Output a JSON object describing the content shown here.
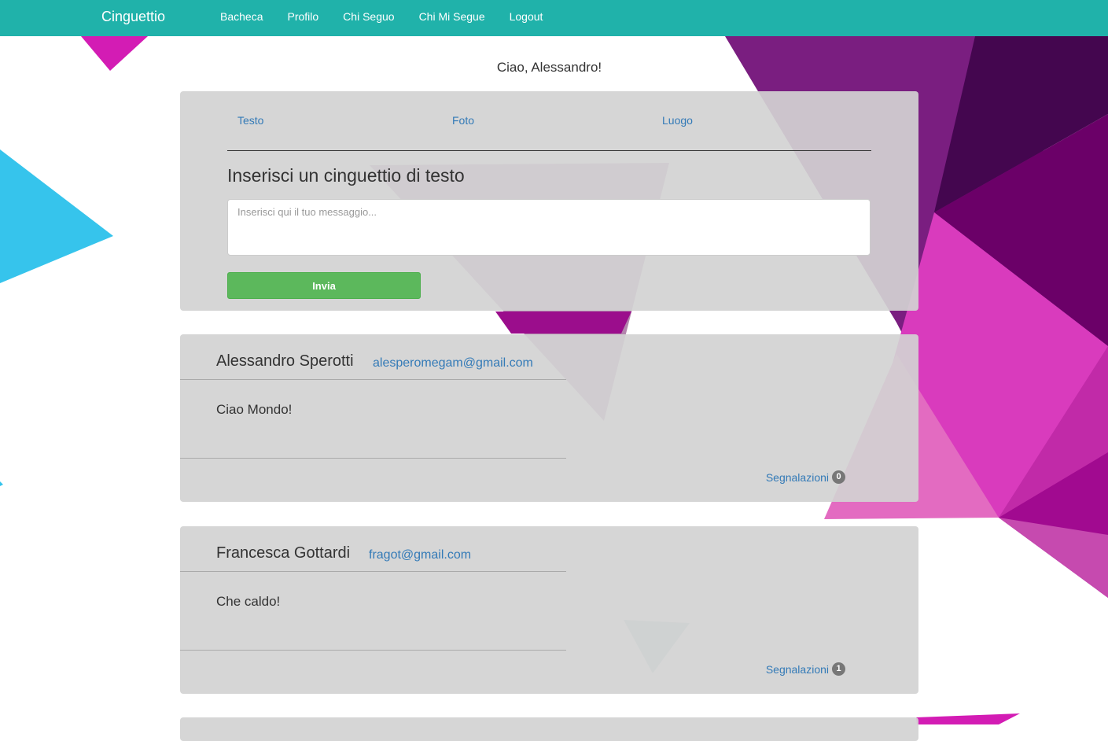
{
  "colors": {
    "navbar": "#20b2aa",
    "link": "#337ab7",
    "send_button": "#5cb85c",
    "panel": "#d3d3d3"
  },
  "navbar": {
    "brand": "Cinguettio",
    "links": [
      "Bacheca",
      "Profilo",
      "Chi Seguo",
      "Chi Mi Segue",
      "Logout"
    ]
  },
  "greeting": "Ciao, Alessandro!",
  "composer": {
    "tabs": [
      "Testo",
      "Foto",
      "Luogo"
    ],
    "title": "Inserisci un cinguettio di testo",
    "placeholder": "Inserisci qui il tuo messaggio...",
    "send_label": "Invia"
  },
  "posts": [
    {
      "author": "Alessandro Sperotti",
      "email": "alesperomegam@gmail.com",
      "text": "Ciao Mondo!",
      "reports_label": "Segnalazioni",
      "reports_count": "0"
    },
    {
      "author": "Francesca Gottardi",
      "email": "fragot@gmail.com",
      "text": "Che caldo!",
      "reports_label": "Segnalazioni",
      "reports_count": "1"
    }
  ]
}
